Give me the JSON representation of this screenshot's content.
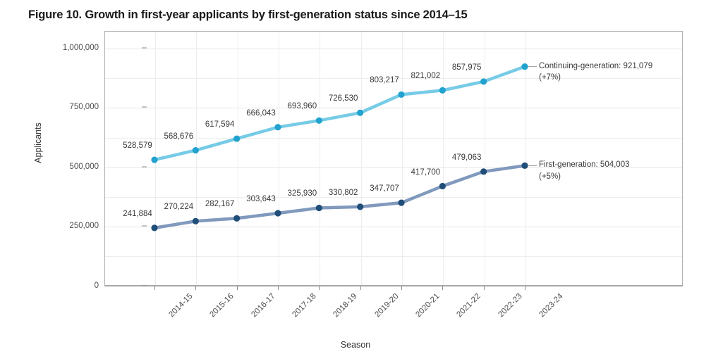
{
  "figure": {
    "title": "Figure 10. Growth in first-year applicants by first-generation status since 2014–15"
  },
  "chart_data": {
    "type": "line",
    "title": "Figure 10. Growth in first-year applicants by first-generation status since 2014–15",
    "xlabel": "Season",
    "ylabel": "Applicants",
    "categories": [
      "2014-15",
      "2015-16",
      "2016-17",
      "2017-18",
      "2018-19",
      "2019-20",
      "2020-21",
      "2021-22",
      "2022-23",
      "2023-24"
    ],
    "ylim": [
      0,
      1000000
    ],
    "ytick_values": [
      0,
      250000,
      500000,
      750000,
      1000000
    ],
    "ytick_labels": [
      "0",
      "250,000",
      "500,000",
      "750,000",
      "1,000,000"
    ],
    "minor_gridline_values": [
      125000,
      375000,
      625000,
      875000
    ],
    "grid": true,
    "legend": "end-of-line annotations",
    "series": [
      {
        "name": "Continuing-generation",
        "color": "#22a2ce",
        "line_color": "#76cbe6",
        "values": [
          528579,
          568676,
          617594,
          666043,
          693960,
          726530,
          803217,
          821002,
          857975,
          921079
        ],
        "labels": [
          "528,579",
          "568,676",
          "617,594",
          "666,043",
          "693,960",
          "726,530",
          "803,217",
          "821,002",
          "857,975",
          "921,079"
        ],
        "end_label_line1": "Continuing-generation: 921,079",
        "end_label_line2": "(+7%)"
      },
      {
        "name": "First-generation",
        "color": "#1f4e79",
        "line_color": "#8099bd",
        "values": [
          241884,
          270224,
          282167,
          303643,
          325930,
          330802,
          347707,
          417700,
          479063,
          504003
        ],
        "labels": [
          "241,884",
          "270,224",
          "282,167",
          "303,643",
          "325,930",
          "330,802",
          "347,707",
          "417,700",
          "479,063",
          "504,003"
        ],
        "end_label_line1": "First-generation: 504,003",
        "end_label_line2": "(+5%)"
      }
    ]
  }
}
